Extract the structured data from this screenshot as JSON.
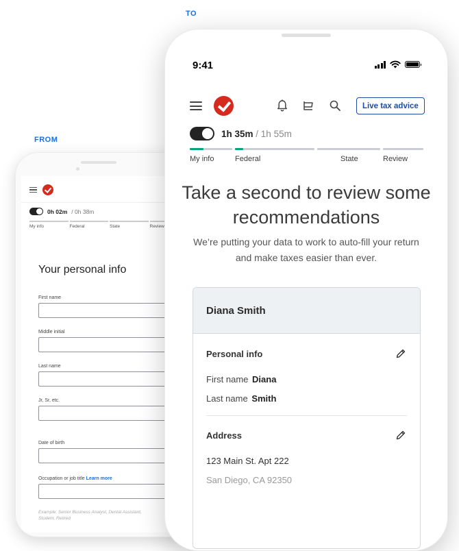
{
  "labels": {
    "from": "FROM",
    "to": "TO"
  },
  "from_screen": {
    "timer_elapsed": "0h 02m",
    "timer_total": "/ 0h 38m",
    "steps": [
      "My info",
      "Federal",
      "State",
      "Review"
    ],
    "title": "Your personal info",
    "fields": [
      {
        "label": "First name"
      },
      {
        "label": "Middle initial"
      },
      {
        "label": "Last name"
      },
      {
        "label": "Jr, Sr, etc."
      },
      {
        "label": "Date of birth"
      },
      {
        "label": "Occupation or job title",
        "link": "Learn more"
      }
    ],
    "example_text": "Example: Senior Business Analyst, Dental Assistant, Student, Retired"
  },
  "to_screen": {
    "status_time": "9:41",
    "live_button": "Live tax advice",
    "timer_elapsed": "1h 35m",
    "timer_total": "/ 1h 55m",
    "steps": [
      {
        "label": "My info",
        "progress": 0.33
      },
      {
        "label": "Federal",
        "progress": 0.1
      },
      {
        "label": "State",
        "progress": 0
      },
      {
        "label": "Review",
        "progress": 0
      }
    ],
    "headline": "Take a second to review some recommendations",
    "subtext": "We’re putting your data to work to auto-fill your return and make taxes easier than ever.",
    "card": {
      "name": "Diana Smith",
      "personal_title": "Personal info",
      "first_name_label": "First name",
      "first_name_value": "Diana",
      "last_name_label": "Last name",
      "last_name_value": "Smith",
      "address_title": "Address",
      "address_line1": "123 Main St. Apt 222",
      "address_line2": "San Diego, CA 92350"
    },
    "colors": {
      "accent": "#0aa37f",
      "brand": "#d52b1e",
      "link": "#1e4c9a"
    }
  }
}
